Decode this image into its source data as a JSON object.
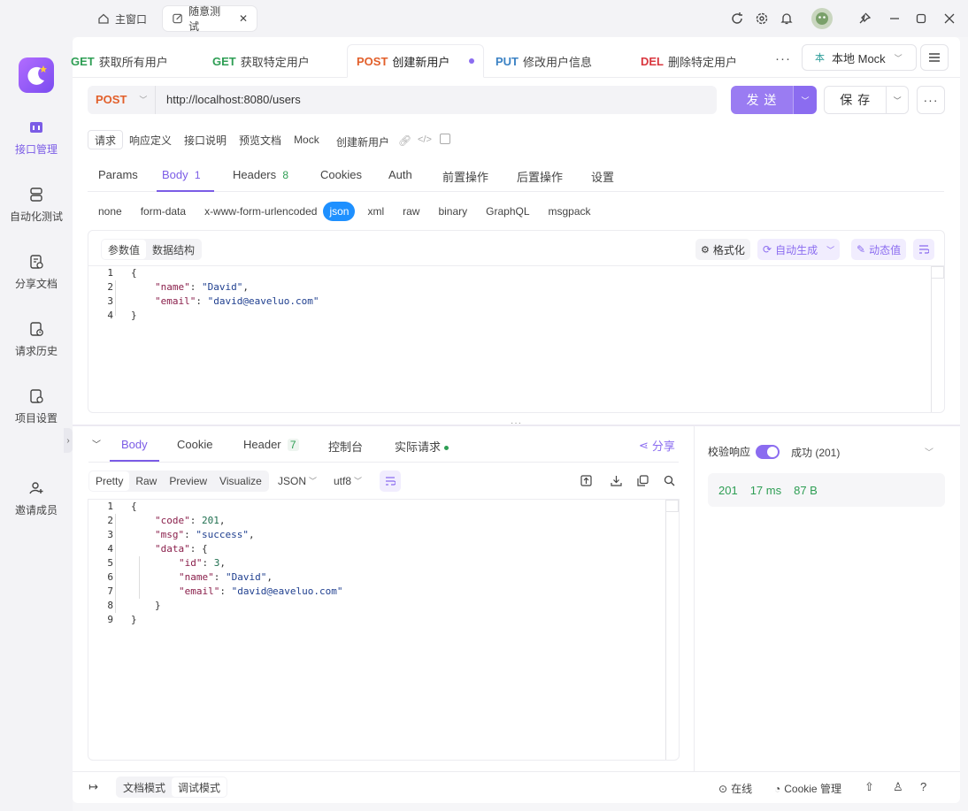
{
  "window": {
    "tabs": [
      {
        "label": "主窗口",
        "icon": "home-icon",
        "active": false
      },
      {
        "label": "随意测试",
        "icon": "edit-icon",
        "active": true
      }
    ]
  },
  "sidebar": {
    "items": [
      {
        "label": "接口管理",
        "icon": "api-icon",
        "active": true
      },
      {
        "label": "自动化测试",
        "icon": "automation-icon"
      },
      {
        "label": "分享文档",
        "icon": "share-doc-icon"
      },
      {
        "label": "请求历史",
        "icon": "history-icon"
      },
      {
        "label": "项目设置",
        "icon": "settings-icon"
      },
      {
        "label": "邀请成员",
        "icon": "invite-icon"
      }
    ]
  },
  "request_tabs": [
    {
      "method": "GET",
      "name": "获取所有用户"
    },
    {
      "method": "GET",
      "name": "获取特定用户"
    },
    {
      "method": "POST",
      "name": "创建新用户",
      "active": true
    },
    {
      "method": "PUT",
      "name": "修改用户信息"
    },
    {
      "method": "DEL",
      "name": "删除特定用户"
    }
  ],
  "env": {
    "label": "本地 Mock",
    "badge": "本"
  },
  "url_bar": {
    "method": "POST",
    "url": "http://localhost:8080/users",
    "send": "发 送",
    "save": "保 存"
  },
  "subtabs": [
    "请求",
    "响应定义",
    "接口说明",
    "预览文档",
    "Mock"
  ],
  "endpoint_name": "创建新用户",
  "param_tabs": [
    {
      "label": "Params"
    },
    {
      "label": "Body",
      "count": "1",
      "active": true
    },
    {
      "label": "Headers",
      "count": "8"
    },
    {
      "label": "Cookies"
    },
    {
      "label": "Auth"
    },
    {
      "label": "前置操作"
    },
    {
      "label": "后置操作"
    },
    {
      "label": "设置"
    }
  ],
  "body_types": [
    "none",
    "form-data",
    "x-www-form-urlencoded",
    "json",
    "xml",
    "raw",
    "binary",
    "GraphQL",
    "msgpack"
  ],
  "body_active": "json",
  "body_view": {
    "tabs": [
      "参数值",
      "数据结构"
    ],
    "format": "格式化",
    "autogen": "自动生成",
    "dynamic": "动态值"
  },
  "request_body": [
    {
      "n": "1",
      "text": "{"
    },
    {
      "n": "2",
      "k": "\"name\"",
      "v": "\"David\"",
      "suffix": ","
    },
    {
      "n": "3",
      "k": "\"email\"",
      "v": "\"david@eaveluo.com\""
    },
    {
      "n": "4",
      "text": "}"
    }
  ],
  "response": {
    "tabs": [
      {
        "label": "Body",
        "active": true
      },
      {
        "label": "Cookie"
      },
      {
        "label": "Header",
        "count": "7"
      },
      {
        "label": "控制台"
      },
      {
        "label": "实际请求"
      }
    ],
    "share": "分享",
    "views": [
      "Pretty",
      "Raw",
      "Preview",
      "Visualize"
    ],
    "format": "JSON",
    "encoding": "utf8",
    "body": [
      {
        "n": "1",
        "indent": 0,
        "text": "{"
      },
      {
        "n": "2",
        "indent": 1,
        "k": "\"code\"",
        "v": "201",
        "vt": "num",
        "suffix": ","
      },
      {
        "n": "3",
        "indent": 1,
        "k": "\"msg\"",
        "v": "\"success\"",
        "vt": "str",
        "suffix": ","
      },
      {
        "n": "4",
        "indent": 1,
        "k": "\"data\"",
        "v": "{",
        "vt": "plain"
      },
      {
        "n": "5",
        "indent": 2,
        "k": "\"id\"",
        "v": "3",
        "vt": "num",
        "suffix": ","
      },
      {
        "n": "6",
        "indent": 2,
        "k": "\"name\"",
        "v": "\"David\"",
        "vt": "str",
        "suffix": ","
      },
      {
        "n": "7",
        "indent": 2,
        "k": "\"email\"",
        "v": "\"david@eaveluo.com\"",
        "vt": "str"
      },
      {
        "n": "8",
        "indent": 1,
        "text": "}"
      },
      {
        "n": "9",
        "indent": 0,
        "text": "}"
      }
    ]
  },
  "validation": {
    "label": "校验响应",
    "result": "成功 (201)",
    "status": "201",
    "time": "17 ms",
    "size": "87 B"
  },
  "footer": {
    "modes": [
      "文档模式",
      "调试模式"
    ],
    "online": "在线",
    "cookie": "Cookie 管理"
  },
  "colors": {
    "accent": "#8b6cf0",
    "post": "#e25f2a",
    "get": "#2e9e54",
    "put": "#3b82c4",
    "del": "#d9363e",
    "success": "#2e9e54"
  }
}
